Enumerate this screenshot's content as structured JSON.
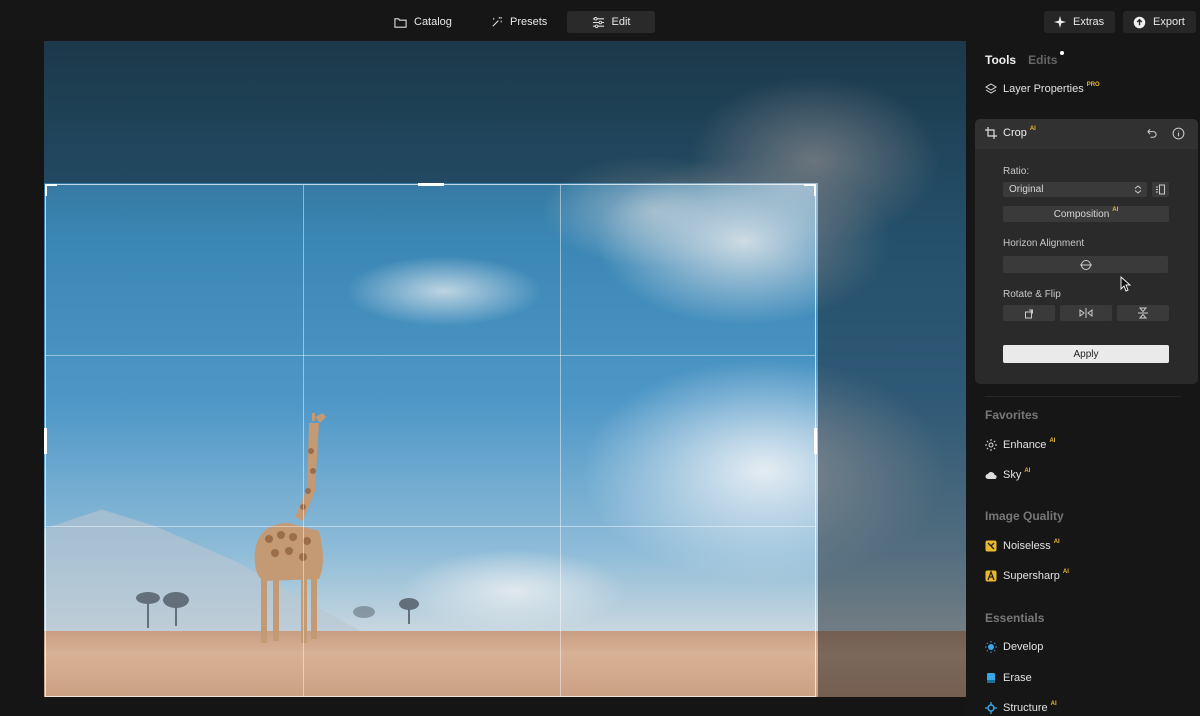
{
  "topbar": {
    "catalog_label": "Catalog",
    "presets_label": "Presets",
    "edit_label": "Edit",
    "extras_label": "Extras",
    "export_label": "Export"
  },
  "panel": {
    "tab_tools": "Tools",
    "tab_edits": "Edits",
    "layer_properties": "Layer Properties",
    "pro_badge": "PRO",
    "ai_badge": "AI",
    "crop": {
      "title": "Crop",
      "ratio_label": "Ratio:",
      "ratio_value": "Original",
      "composition_label": "Composition",
      "horizon_label": "Horizon Alignment",
      "rotate_label": "Rotate & Flip",
      "apply_label": "Apply"
    },
    "favorites_title": "Favorites",
    "enhance_label": "Enhance",
    "sky_label": "Sky",
    "image_quality_title": "Image Quality",
    "noiseless_label": "Noiseless",
    "supersharp_label": "Supersharp",
    "essentials_title": "Essentials",
    "develop_label": "Develop",
    "erase_label": "Erase",
    "structure_label": "Structure"
  },
  "colors": {
    "accent_ai": "#e9b82f",
    "develop_icon": "#3aa7e8",
    "erase_icon": "#3aa7e8",
    "structure_icon": "#3aa7e8",
    "noiseless_icon": "#e9b82f",
    "supersharp_icon": "#e9b82f"
  }
}
